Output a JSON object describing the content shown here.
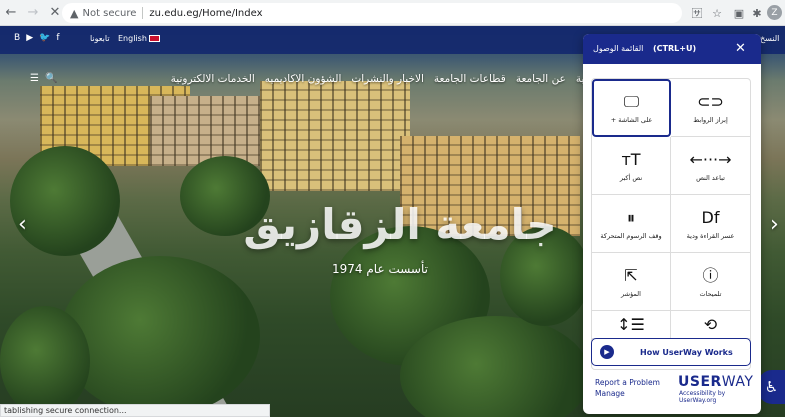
{
  "browser": {
    "url_warning": "Not secure",
    "url": "zu.edu.eg/Home/Index",
    "profile_initial": "Z"
  },
  "site": {
    "social": [
      "B",
      "▶",
      "🐦",
      "f"
    ],
    "follow_label": "تابعونا",
    "english_label": "English",
    "top_right_label": "النسخ",
    "nav": [
      "الرئيسية",
      "عن الجامعة",
      "قطاعات الجامعة",
      "الاخبار والنشرات",
      "الشؤون الاكاديميه",
      "الخدمات الالكترونية"
    ],
    "hero_title": "جامعة الزقازيق",
    "hero_subtitle": "تأسست عام 1974",
    "status_text": "tablishing secure connection..."
  },
  "userway": {
    "menu_title": "القائمة الوصول",
    "shortcut": "(CTRL+U)",
    "tiles": [
      {
        "icon": "monitor-icon",
        "glyph": "🖵",
        "label": "+ على الشاشة",
        "active": true
      },
      {
        "icon": "link-icon",
        "glyph": "⊂⊃",
        "label": "إبراز الروابط",
        "active": false
      },
      {
        "icon": "text-size-icon",
        "glyph": "ᴛT",
        "label": "نص أكبر",
        "active": false
      },
      {
        "icon": "text-spacing-icon",
        "glyph": "←···→",
        "label": "تباعد النص",
        "active": false
      },
      {
        "icon": "pause-animation-icon",
        "glyph": "⏸",
        "label": "وقف الرسوم المتحركة",
        "active": false
      },
      {
        "icon": "dyslexia-font-icon",
        "glyph": "Df",
        "label": "عسر القراءة ودية",
        "active": false
      },
      {
        "icon": "cursor-icon",
        "glyph": "⇱",
        "label": "المؤشر",
        "active": false
      },
      {
        "icon": "tooltip-icon",
        "glyph": "ⓘ",
        "label": "تلميحات",
        "active": false
      },
      {
        "icon": "line-height-icon",
        "glyph": "↕☰",
        "label": "",
        "active": false
      },
      {
        "icon": "reset-icon",
        "glyph": "⟲",
        "label": "",
        "active": false
      }
    ],
    "how_label": "How UserWay Works",
    "report_line1": "Report a Problem",
    "report_line2": "Manage",
    "brand_bold": "USER",
    "brand_light": "WAY",
    "brand_by": "Accessibility by UserWay.org"
  }
}
